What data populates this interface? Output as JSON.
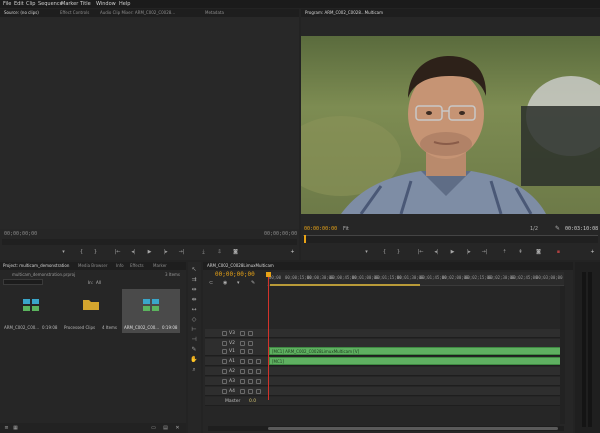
{
  "menu": [
    "File",
    "Edit",
    "Clip",
    "Sequence",
    "Marker",
    "Title",
    "Window",
    "Help"
  ],
  "source_panel": {
    "tabs": [
      "Source: (no clips)",
      "Effect Controls",
      "Audio Clip Mixer: ARM_C002_C0028...",
      "Metadata"
    ],
    "timecode_left": "00;00;00;00",
    "timecode_right": "00;00;00;00"
  },
  "program_panel": {
    "tab": "Program: ARM_C002_C0028...Multicam",
    "timecode_left": "00:00:00:00",
    "fit": "Fit",
    "quality": "1/2",
    "timecode_right": "00:03:10:08"
  },
  "project_panel": {
    "tabs": [
      "Project: multicam_demonstration",
      "Media Browser",
      "Info",
      "Effects",
      "Marker"
    ],
    "path": "multicam_demonstration.prproj",
    "item_count": "3 Items",
    "search_label": "In:",
    "search_value": "All",
    "items": [
      {
        "name": "ARM_C002_C00...",
        "duration": "0:19:08",
        "icon": "multicam-icon"
      },
      {
        "name": "Processed Clips",
        "duration": "4 Items",
        "icon": "folder-icon"
      },
      {
        "name": "ARM_C002_C00...",
        "duration": "0:19:08",
        "icon": "multicam-icon"
      }
    ]
  },
  "timeline": {
    "tab": "ARM_C002_C0028LimuxMulticam",
    "timecode": "00;00;00;00",
    "ruler": [
      "00;00",
      "00;00;15;00",
      "00;00;30;00",
      "00;00;45;00",
      "00;01;00;00",
      "00;01;15;00",
      "00;01;30;00",
      "00;01;45;00",
      "00;02;00;00",
      "00;02;15;00",
      "00;02;30;00",
      "00;02;45;00",
      "00;03;00;00"
    ],
    "video_tracks": [
      "V3",
      "V2",
      "V1"
    ],
    "audio_tracks": [
      "A1",
      "A2",
      "A3",
      "A4"
    ],
    "master_label": "Master",
    "master_value": "0.0",
    "clip_v1": "[MC1] ARM_C002_C0028LimuxMulticam [V]",
    "clip_a1": "[MC1]"
  },
  "colors": {
    "accent_timecode": "#e8a317",
    "clip_green": "#5fb061",
    "playhead": "#d2332b"
  }
}
